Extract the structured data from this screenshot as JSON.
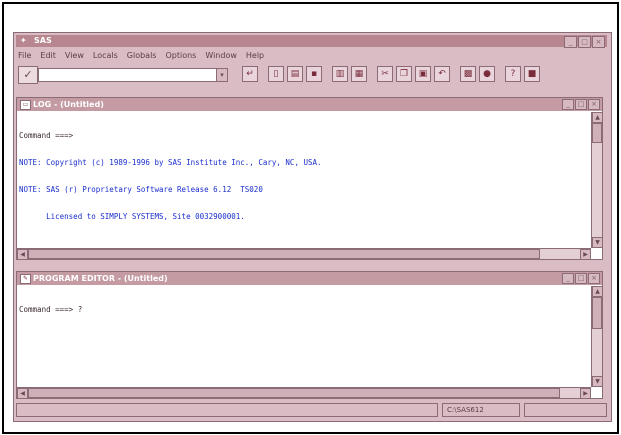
{
  "app": {
    "title": "SAS",
    "title_icon": "sas-icon",
    "window_buttons": [
      "_",
      "□",
      "×"
    ]
  },
  "menu": [
    "File",
    "Edit",
    "View",
    "Locals",
    "Globals",
    "Options",
    "Window",
    "Help"
  ],
  "toolbar": {
    "checkmark": "✓",
    "command_value": "",
    "dropdown": "▾",
    "tools": [
      "↵",
      "new-icon",
      "open-icon",
      "save-icon",
      "print-icon",
      "print-preview-icon",
      "cut-icon",
      "copy-icon",
      "paste-icon",
      "undo-icon",
      "library-icon",
      "explorer-icon",
      "help-icon",
      "stop-icon"
    ]
  },
  "log": {
    "title": "LOG - (Untitled)",
    "command": "Command ===>",
    "notes": [
      "NOTE: Copyright (c) 1989-1996 by SAS Institute Inc., Cary, NC, USA.",
      "NOTE: SAS (r) Proprietary Software Release 6.12  TS020",
      "      Licensed to SIMPLY SYSTEMS, Site 0032900001."
    ]
  },
  "editor": {
    "title": "PROGRAM EDITOR - (Untitled)",
    "command": "Command ===> ?"
  },
  "status": {
    "path": "C:\\SAS612"
  },
  "colors": {
    "accent": "#b8868f",
    "note_text": "#1a2ecc",
    "chrome": "#d9bcc4"
  }
}
